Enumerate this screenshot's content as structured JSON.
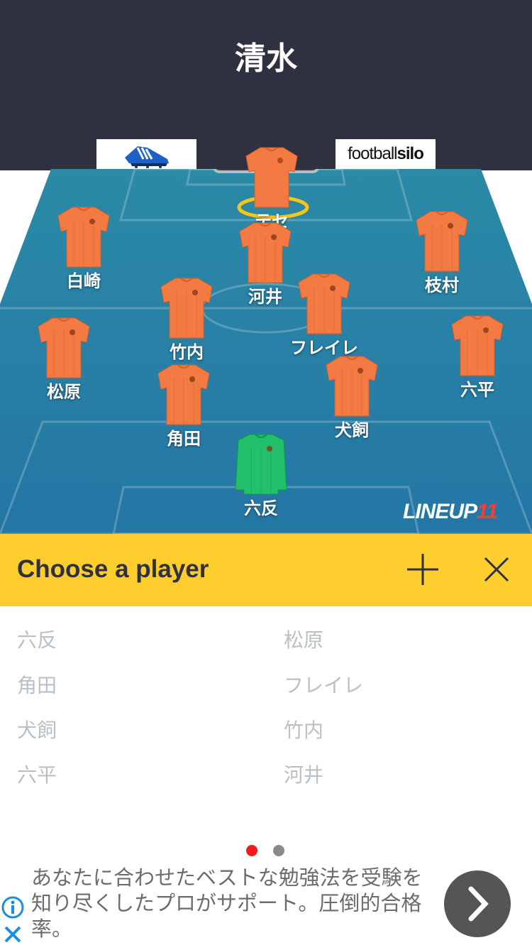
{
  "header": {
    "team_name": "清水",
    "sponsor_right": {
      "prefix": "football",
      "bold": "silo"
    }
  },
  "pitch": {
    "colors": {
      "pitch": "#2a7fa3",
      "outfield_shirt": "#f47a43",
      "goalkeeper_shirt": "#22c06a"
    },
    "players": [
      {
        "name": "白崎",
        "role": "outfield"
      },
      {
        "name": "河井",
        "role": "outfield"
      },
      {
        "name": "枝村",
        "role": "outfield"
      },
      {
        "name": "竹内",
        "role": "outfield"
      },
      {
        "name": "フレイレ",
        "role": "outfield"
      },
      {
        "name": "松原",
        "role": "outfield"
      },
      {
        "name": "六平",
        "role": "outfield"
      },
      {
        "name": "角田",
        "role": "outfield"
      },
      {
        "name": "犬飼",
        "role": "outfield"
      },
      {
        "name": "六反",
        "role": "goalkeeper"
      }
    ],
    "selected_player": {
      "name": "テセ"
    },
    "logo": {
      "text": "LINEUP",
      "number": "11"
    }
  },
  "chooser": {
    "title": "Choose a player",
    "players": [
      "六反",
      "松原",
      "角田",
      "フレイレ",
      "犬飼",
      "竹内",
      "六平",
      "河井"
    ]
  },
  "pager": {
    "pages": 2,
    "current": 1
  },
  "ad": {
    "text": "あなたに合わせたベストな勉強法を受験を知り尽くしたプロがサポート。圧倒的合格率。"
  }
}
